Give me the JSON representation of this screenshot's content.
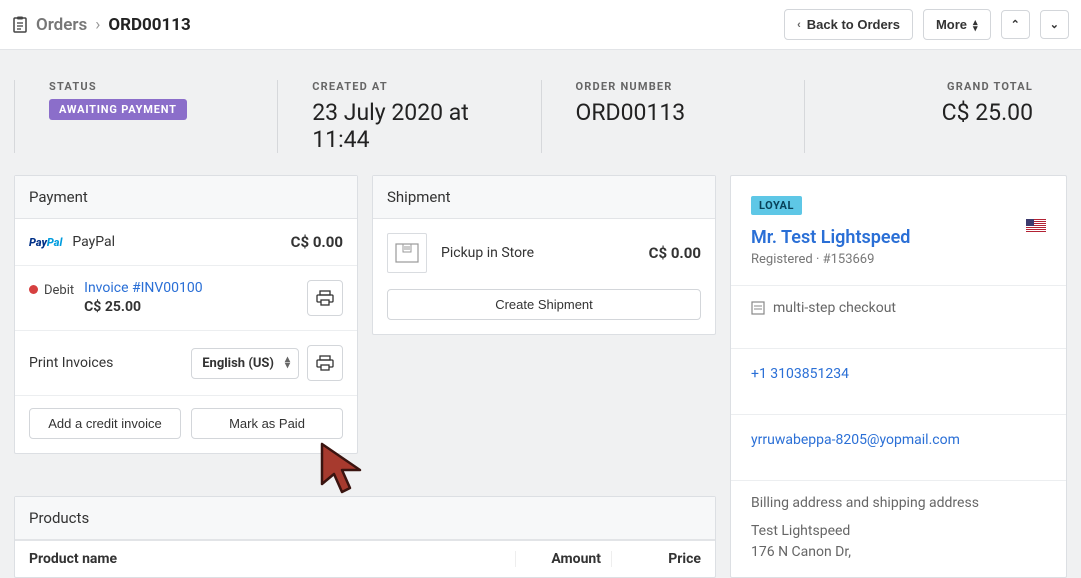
{
  "breadcrumb": {
    "parent": "Orders",
    "current": "ORD00113"
  },
  "topbar": {
    "back_label": "Back to Orders",
    "more_label": "More"
  },
  "summary": {
    "status_label": "STATUS",
    "status_value": "AWAITING PAYMENT",
    "created_label": "CREATED AT",
    "created_value": "23 July 2020 at 11:44",
    "ordernum_label": "ORDER NUMBER",
    "ordernum_value": "ORD00113",
    "total_label": "GRAND TOTAL",
    "total_value": "C$ 25.00"
  },
  "payment": {
    "title": "Payment",
    "paypal_label": "PayPal",
    "paypal_amount": "C$ 0.00",
    "debit_label": "Debit",
    "invoice_link": "Invoice #INV00100",
    "invoice_amount": "C$ 25.00",
    "print_invoices_label": "Print Invoices",
    "language_selected": "English (US)",
    "add_credit_label": "Add a credit invoice",
    "mark_paid_label": "Mark as Paid"
  },
  "shipment": {
    "title": "Shipment",
    "method": "Pickup in Store",
    "amount": "C$ 0.00",
    "create_label": "Create Shipment"
  },
  "customer": {
    "loyal_badge": "LOYAL",
    "name": "Mr. Test Lightspeed",
    "sub": "Registered · #153669",
    "checkout": "multi-step checkout",
    "phone": "+1 3103851234",
    "email": "yrruwabeppa-8205@yopmail.com",
    "addr_label": "Billing address and shipping address",
    "addr_name": "Test Lightspeed",
    "addr_line1": "176 N Canon Dr,"
  },
  "products": {
    "title": "Products",
    "col_name": "Product name",
    "col_amount": "Amount",
    "col_price": "Price"
  }
}
